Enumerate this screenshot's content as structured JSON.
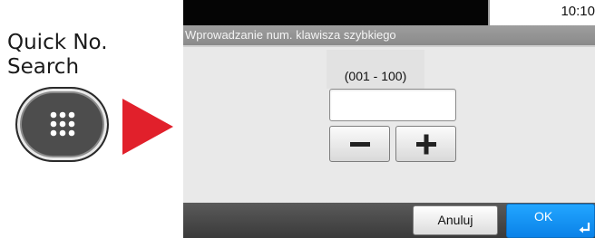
{
  "instruction": {
    "key_label": "Quick No.\nSearch",
    "key_icon": "keypad-icon",
    "arrow_color": "#e1202b"
  },
  "screen": {
    "clock": "10:10",
    "title": "Wprowadzanie num. klawisza szybkiego",
    "range_label": "(001 - 100)",
    "number_input": {
      "value": "",
      "placeholder": ""
    },
    "minus_icon": "minus-icon",
    "plus_icon": "plus-icon",
    "cancel_label": "Anuluj",
    "ok_label": "OK",
    "ok_icon": "enter-icon",
    "accent_color": "#1a96f5"
  }
}
